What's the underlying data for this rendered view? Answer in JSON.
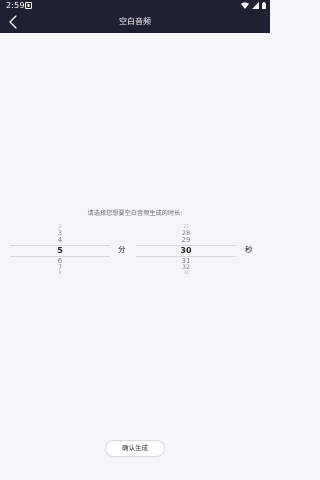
{
  "status_bar": {
    "time": "2:59",
    "icons": [
      "notification-app-icon",
      "wifi-icon",
      "signal-icon",
      "battery-icon"
    ]
  },
  "header": {
    "title": "空白音频",
    "back_icon": "chevron-left-icon"
  },
  "prompt": "请选择您想要空白音频生成的时长:",
  "minute_picker": {
    "items_above": [
      "2",
      "3",
      "4"
    ],
    "selected": "5",
    "items_below": [
      "6",
      "7",
      "8"
    ],
    "unit": "分"
  },
  "second_picker": {
    "items_above": [
      "27",
      "28",
      "29"
    ],
    "selected": "30",
    "items_below": [
      "31",
      "32",
      "33"
    ],
    "unit": "秒"
  },
  "confirm_button": "确认生成",
  "colors": {
    "header_background": "#1e2130",
    "page_background": "#f6f6f8",
    "selected_text": "#222222",
    "unselected_text": "#7d8089"
  }
}
